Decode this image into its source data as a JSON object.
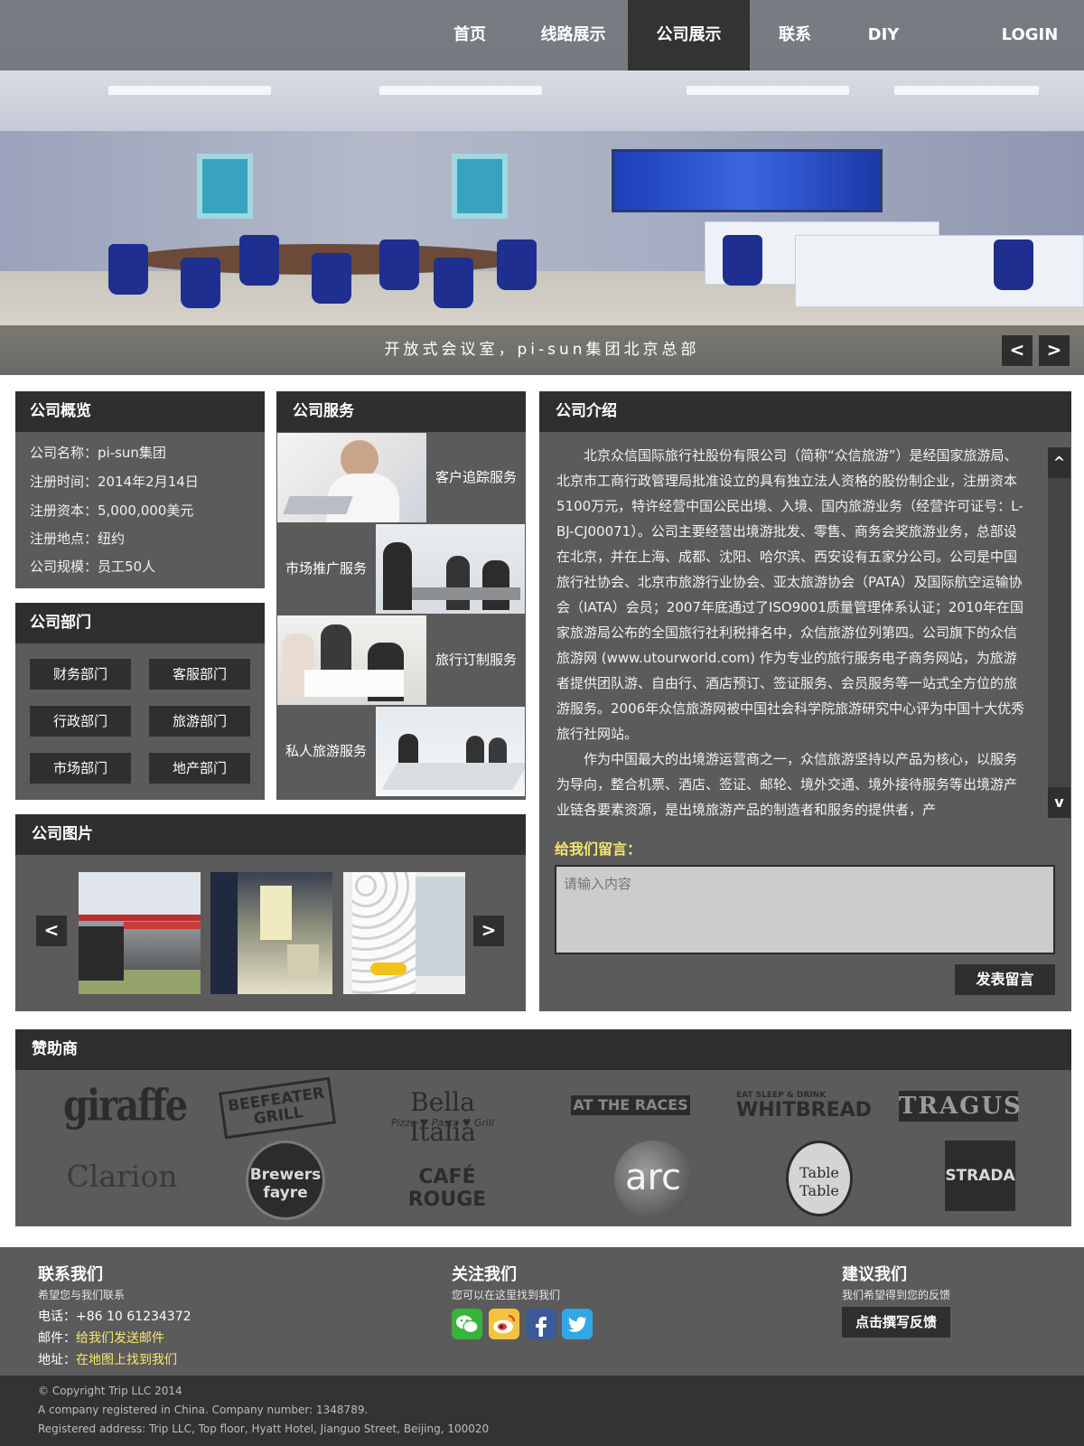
{
  "nav": {
    "items": [
      "首页",
      "线路展示",
      "公司展示",
      "联系",
      "DIY"
    ],
    "active_index": 2,
    "login": "LOGIN"
  },
  "hero": {
    "caption": "开放式会议室，pi-sun集团北京总部",
    "prev": "<",
    "next": ">"
  },
  "overview": {
    "title": "公司概览",
    "lines": [
      "公司名称：pi-sun集团",
      "注册时间：2014年2月14日",
      "注册资本：5,000,000美元",
      "注册地点：纽约",
      "公司规模：员工50人"
    ]
  },
  "departments": {
    "title": "公司部门",
    "items": [
      "财务部门",
      "客服部门",
      "行政部门",
      "旅游部门",
      "市场部门",
      "地产部门"
    ]
  },
  "services": {
    "title": "公司服务",
    "items": [
      "客户追踪服务",
      "市场推广服务",
      "旅行订制服务",
      "私人旅游服务"
    ]
  },
  "gallery": {
    "title": "公司图片",
    "prev": "<",
    "next": ">"
  },
  "intro": {
    "title": "公司介绍",
    "paragraphs": [
      "北京众信国际旅行社股份有限公司（简称“众信旅游”）是经国家旅游局、北京市工商行政管理局批准设立的具有独立法人资格的股份制企业，注册资本5100万元，特许经营中国公民出境、入境、国内旅游业务（经营许可证号：L-BJ-CJ00071）。公司主要经营出境游批发、零售、商务会奖旅游业务，总部设在北京，并在上海、成都、沈阳、哈尔滨、西安设有五家分公司。公司是中国旅行社协会、北京市旅游行业协会、亚太旅游协会（PATA）及国际航空运输协会（IATA）会员；2007年底通过了ISO9001质量管理体系认证；2010年在国家旅游局公布的全国旅行社利税排名中，众信旅游位列第四。公司旗下的众信旅游网 (www.utourworld.com) 作为专业的旅行服务电子商务网站，为旅游者提供团队游、自由行、酒店预订、签证服务、会员服务等一站式全方位的旅游服务。2006年众信旅游网被中国社会科学院旅游研究中心评为中国十大优秀旅行社网站。",
      "作为中国最大的出境游运营商之一，众信旅游坚持以产品为核心，以服务为导向，整合机票、酒店、签证、邮轮、境外交通、境外接待服务等出境游产业链各要素资源，是出境旅游产品的制造者和服务的提供者，产"
    ],
    "scroll_up": "^",
    "scroll_down": "v",
    "message_label": "给我们留言：",
    "message_placeholder": "请输入内容",
    "submit": "发表留言"
  },
  "sponsors": {
    "title": "赞助商",
    "logos": [
      "giraffe",
      "BEEFEATER GRILL",
      "Bella Italia",
      "AT THE RACES",
      "WHITBREAD",
      "TRAGUS",
      "Clarion",
      "Brewers fayre",
      "CAFÉ ROUGE",
      "arc",
      "Table Table",
      "STRADA"
    ],
    "logo_subtexts": {
      "bella": "Pizza ♥ Pasta ♥ Grill",
      "whitbread": "EAT SLEEP & DRINK"
    }
  },
  "footer": {
    "contact": {
      "title": "联系我们",
      "subtitle": "希望您与我们联系",
      "phone_label": "电话：",
      "phone": "+86 10 61234372",
      "mail_label": "邮件：",
      "mail": "给我们发送邮件",
      "address_label": "地址：",
      "address": "在地图上找到我们"
    },
    "follow": {
      "title": "关注我们",
      "subtitle": "您可以在这里找到我们",
      "icons": [
        "wechat-icon",
        "weibo-icon",
        "facebook-icon",
        "twitter-icon"
      ]
    },
    "suggest": {
      "title": "建议我们",
      "subtitle": "我们希望得到您的反馈",
      "button": "点击撰写反馈"
    }
  },
  "copyright": {
    "line1": "© Copyright Trip LLC 2014",
    "line2": "A company registered in China. Company number: 1348789.",
    "line3": "Registered address: Trip LLC, Top floor, Hyatt Hotel, Jianguo Street, Beijing, 100020"
  },
  "colors": {
    "panel_bg": "#5b5b5b",
    "panel_head": "#2f2f2f",
    "accent_yellow": "#f7e66e",
    "footer_bg": "#5b5b5b",
    "copyright_bg": "#333333"
  }
}
